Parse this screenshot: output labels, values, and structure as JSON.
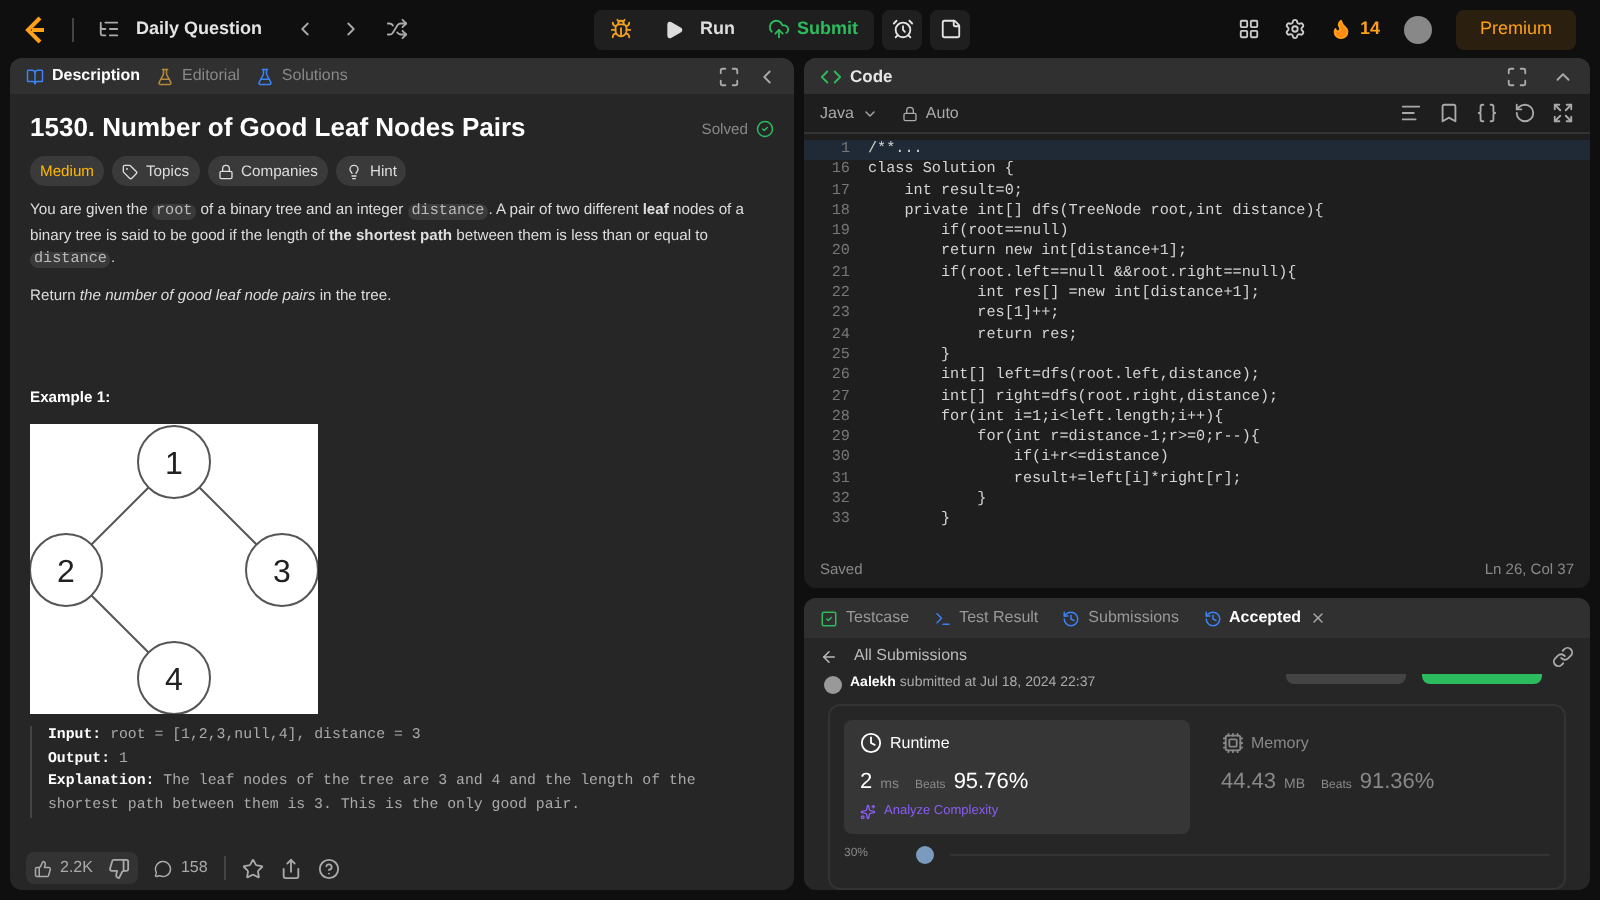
{
  "top_bar": {
    "title": "Daily Question",
    "run": "Run",
    "submit": "Submit",
    "streak": "14",
    "premium": "Premium"
  },
  "left_panel": {
    "tabs": [
      {
        "label": "Description",
        "selected": true
      },
      {
        "label": "Editorial",
        "selected": false
      },
      {
        "label": "Solutions",
        "selected": false
      }
    ],
    "title": "1530. Number of Good Leaf Nodes Pairs",
    "status": "Solved",
    "tags": [
      {
        "kind": "difficulty",
        "label": "Medium"
      },
      {
        "kind": "topics",
        "label": "Topics"
      },
      {
        "kind": "companies",
        "label": "Companies"
      },
      {
        "kind": "hint",
        "label": "Hint"
      }
    ],
    "paragraphs": [
      [
        {
          "kind": "text",
          "text": "You are given the "
        },
        {
          "kind": "code",
          "text": "root"
        },
        {
          "kind": "text",
          "text": " of a binary tree and an integer "
        },
        {
          "kind": "code",
          "text": "distance"
        },
        {
          "kind": "text",
          "text": ". A pair of two different **leaf** nodes of a binary tree is said to be good if the length of **the shortest path** between them is less than or equal to "
        },
        {
          "kind": "code",
          "text": "distance"
        },
        {
          "kind": "text",
          "text": "."
        }
      ],
      [
        {
          "kind": "text",
          "text": "Return *the number of good leaf node pairs* in the tree."
        }
      ]
    ],
    "example_title": "Example 1:",
    "tree_nodes": [
      "1",
      "2",
      "3",
      "4"
    ],
    "example_lines": [
      {
        "label": "Input:",
        "value": "root = [1,2,3,null,4], distance = 3"
      },
      {
        "label": "Output:",
        "value": "1"
      },
      {
        "label": "Explanation:",
        "value": "The leaf nodes of the tree are 3 and 4 and the length of the shortest path between them is 3. This is the only good pair."
      }
    ],
    "likes": "2.2K",
    "comments": "158"
  },
  "code_panel": {
    "title": "Code",
    "language": "Java",
    "mode": "Auto",
    "lines": [
      {
        "num": "1",
        "code": "/**...",
        "highlighted": true
      },
      {
        "num": "16",
        "code": "class Solution {",
        "highlighted": false
      },
      {
        "num": "17",
        "code": "    int result=0;",
        "highlighted": false
      },
      {
        "num": "18",
        "code": "    private int[] dfs(TreeNode root,int distance){",
        "highlighted": false
      },
      {
        "num": "19",
        "code": "        if(root==null)",
        "highlighted": false
      },
      {
        "num": "20",
        "code": "        return new int[distance+1];",
        "highlighted": false
      },
      {
        "num": "21",
        "code": "        if(root.left==null &&root.right==null){",
        "highlighted": false
      },
      {
        "num": "22",
        "code": "            int res[] =new int[distance+1];",
        "highlighted": false
      },
      {
        "num": "23",
        "code": "            res[1]++;",
        "highlighted": false
      },
      {
        "num": "24",
        "code": "            return res;",
        "highlighted": false
      },
      {
        "num": "25",
        "code": "        }",
        "highlighted": false
      },
      {
        "num": "26",
        "code": "        int[] left=dfs(root.left,distance);",
        "highlighted": false
      },
      {
        "num": "27",
        "code": "        int[] right=dfs(root.right,distance);",
        "highlighted": false
      },
      {
        "num": "28",
        "code": "        for(int i=1;i<left.length;i++){",
        "highlighted": false
      },
      {
        "num": "29",
        "code": "            for(int r=distance-1;r>=0;r--){",
        "highlighted": false
      },
      {
        "num": "30",
        "code": "                if(i+r<=distance)",
        "highlighted": false
      },
      {
        "num": "31",
        "code": "                result+=left[i]*right[r];",
        "highlighted": false
      },
      {
        "num": "32",
        "code": "            }",
        "highlighted": false
      },
      {
        "num": "33",
        "code": "        }",
        "highlighted": false
      }
    ],
    "saved": "Saved",
    "cursor": "Ln 26, Col 37"
  },
  "result_panel": {
    "tabs": [
      {
        "label": "Testcase",
        "selected": false,
        "kind": "testcase"
      },
      {
        "label": "Test Result",
        "selected": false,
        "kind": "result"
      },
      {
        "label": "Submissions",
        "selected": false,
        "kind": "submissions"
      },
      {
        "label": "Accepted",
        "selected": true,
        "kind": "accepted"
      }
    ],
    "back": "All Submissions",
    "user": "Aalekh",
    "submitted": "submitted at Jul 18, 2024 22:37",
    "stats": [
      {
        "kind": "runtime",
        "label": "Runtime",
        "value": "2",
        "unit": "ms",
        "beats": "Beats",
        "percent": "95.76%",
        "selected": true
      },
      {
        "kind": "memory",
        "label": "Memory",
        "value": "44.43",
        "unit": "MB",
        "beats": "Beats",
        "percent": "91.36%",
        "selected": false
      }
    ],
    "analyze": "Analyze Complexity",
    "axis_label": "30%"
  }
}
